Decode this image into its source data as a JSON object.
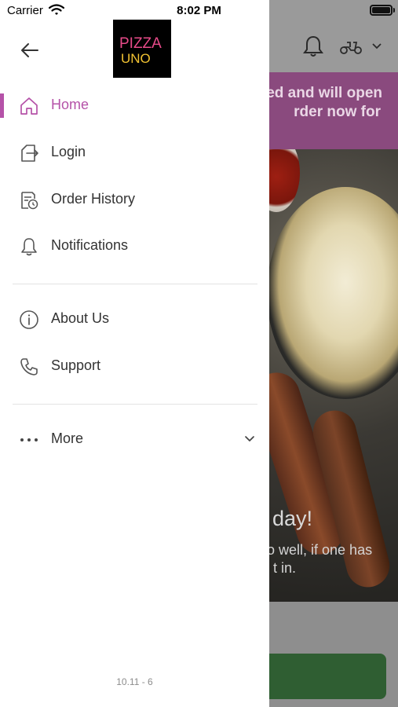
{
  "status_bar": {
    "carrier": "Carrier",
    "time": "8:02 PM"
  },
  "brand": {
    "logo_text_top": "PIZZA",
    "logo_text_bottom": "UNO"
  },
  "drawer": {
    "accent_color": "#b552a8",
    "items": [
      {
        "label": "Home",
        "icon": "home-icon",
        "active": true
      },
      {
        "label": "Login",
        "icon": "login-icon",
        "active": false
      },
      {
        "label": "Order History",
        "icon": "receipt-clock-icon",
        "active": false
      },
      {
        "label": "Notifications",
        "icon": "bell-icon",
        "active": false
      },
      {
        "label": "About Us",
        "icon": "info-icon",
        "active": false
      },
      {
        "label": "Support",
        "icon": "phone-icon",
        "active": false
      },
      {
        "label": "More",
        "icon": "more-dots-icon",
        "active": false
      }
    ],
    "version": "10.11 - 6"
  },
  "background": {
    "banner_line1": "ed and will open",
    "banner_line2": "rder now for",
    "headline": "day!",
    "quote_line1": "o well, if one has",
    "quote_line2": "t in.",
    "banner_color": "#8a4a7e",
    "cta_color": "#2f5e32"
  }
}
